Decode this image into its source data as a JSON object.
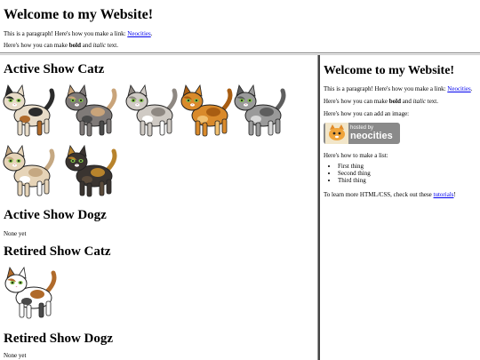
{
  "top": {
    "title": "Welcome to my Website!",
    "para1_prefix": "This is a paragraph! Here's how you make a link: ",
    "para1_link": "Neocities",
    "para1_suffix": ".",
    "para2_prefix": "Here's how you can make ",
    "para2_bold": "bold",
    "para2_mid": " and ",
    "para2_italic": "italic",
    "para2_suffix": " text."
  },
  "left": {
    "active_catz_heading": "Active Show Catz",
    "active_dogz_heading": "Active Show Dogz",
    "active_dogz_text": "None yet",
    "retired_catz_heading": "Retired Show Catz",
    "retired_dogz_heading": "Retired Show Dogz",
    "retired_dogz_text": "None yet",
    "active_cats": [
      {
        "name": "calico cat",
        "body": "#e8dcc8",
        "patch": "#2b2b2b",
        "patch2": "#b06a2a"
      },
      {
        "name": "grey tortie cat",
        "body": "#7f7a78",
        "patch": "#c9a47a",
        "patch2": "#4a4a4a"
      },
      {
        "name": "pale grey cat",
        "body": "#cfcac4",
        "patch": "#8e8882",
        "patch2": "#ffffff"
      },
      {
        "name": "orange cat",
        "body": "#d98a2b",
        "patch": "#a85d12",
        "patch2": "#f1c070"
      },
      {
        "name": "grey tabby cat",
        "body": "#9a9a9a",
        "patch": "#5e5e5e",
        "patch2": "#d8d8d8"
      },
      {
        "name": "cream cat",
        "body": "#e6d4b8",
        "patch": "#c5a882",
        "patch2": "#ffffff"
      },
      {
        "name": "dark tortie cat",
        "body": "#3a3430",
        "patch": "#b8832c",
        "patch2": "#5a4a3a"
      }
    ],
    "retired_cats": [
      {
        "name": "retired calico cat",
        "body": "#ffffff",
        "patch": "#b06a2a",
        "patch2": "#4a4a4a"
      }
    ]
  },
  "right": {
    "title": "Welcome to my Website!",
    "para1_prefix": "This is a paragraph! Here's how you make a link: ",
    "para1_link": "Neocities",
    "para1_suffix": ".",
    "para2_prefix": "Here's how you can make ",
    "para2_bold": "bold",
    "para2_mid": " and ",
    "para2_italic": "italic",
    "para2_suffix": " text.",
    "image_text": "Here's how you can add an image:",
    "badge_small": "hosted by",
    "badge_big": "neocities",
    "list_text": "Here's how to make a list:",
    "list_items": [
      "First thing",
      "Second thing",
      "Third thing"
    ],
    "learn_prefix": "To learn more HTML/CSS, check out these ",
    "learn_link": "tutorials",
    "learn_suffix": "!"
  }
}
